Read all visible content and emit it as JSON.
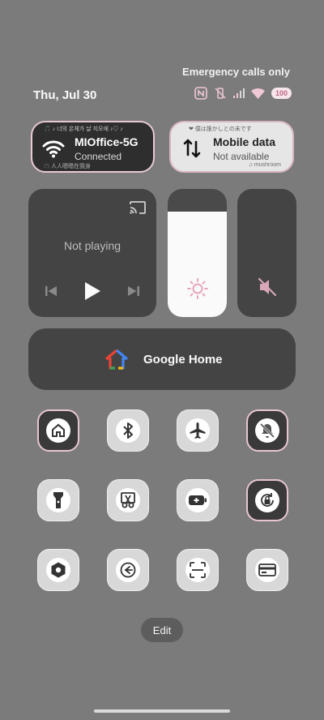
{
  "status": {
    "emergency": "Emergency calls only",
    "date": "Thu, Jul 30",
    "battery_badge": "100"
  },
  "wifi_tile": {
    "title": "MIOffice-5G",
    "subtitle": "Connected",
    "deco_top": "🎵 ♪ 너의 온체가 날 지오에 ♪♡ ♪",
    "deco_bottom": "☁ 人人嗯嗯在我身"
  },
  "mobile_tile": {
    "title": "Mobile data",
    "subtitle": "Not available",
    "deco_top": "❤ 僕は誰かしとの未です",
    "deco_bottom": "♫ mushroom"
  },
  "media": {
    "title": "Not playing"
  },
  "brightness": {
    "level": 0.82
  },
  "google_home": {
    "label": "Google Home"
  },
  "quick_settings": [
    {
      "name": "home-tile",
      "icon": "home-icon",
      "style": "dark"
    },
    {
      "name": "bluetooth-tile",
      "icon": "bluetooth-icon",
      "style": "light"
    },
    {
      "name": "airplane-mode-tile",
      "icon": "airplane-icon",
      "style": "light"
    },
    {
      "name": "dnd-tile",
      "icon": "bell-off-icon",
      "style": "dark"
    },
    {
      "name": "flashlight-tile",
      "icon": "flashlight-icon",
      "style": "light"
    },
    {
      "name": "screenshot-tile",
      "icon": "scissors-icon",
      "style": "light"
    },
    {
      "name": "battery-saver-tile",
      "icon": "battery-plus-icon",
      "style": "light"
    },
    {
      "name": "rotation-lock-tile",
      "icon": "rotation-lock-icon",
      "style": "dark"
    },
    {
      "name": "settings-tile",
      "icon": "hexagon-settings-icon",
      "style": "light"
    },
    {
      "name": "data-saver-tile",
      "icon": "data-saver-icon",
      "style": "light"
    },
    {
      "name": "scan-tile",
      "icon": "scan-icon",
      "style": "light"
    },
    {
      "name": "wallet-tile",
      "icon": "card-icon",
      "style": "light"
    }
  ],
  "edit": {
    "label": "Edit"
  },
  "colors": {
    "background": "#7b7b7b",
    "tile_dark": "#444444",
    "accent_pink": "#e7c6d1"
  }
}
